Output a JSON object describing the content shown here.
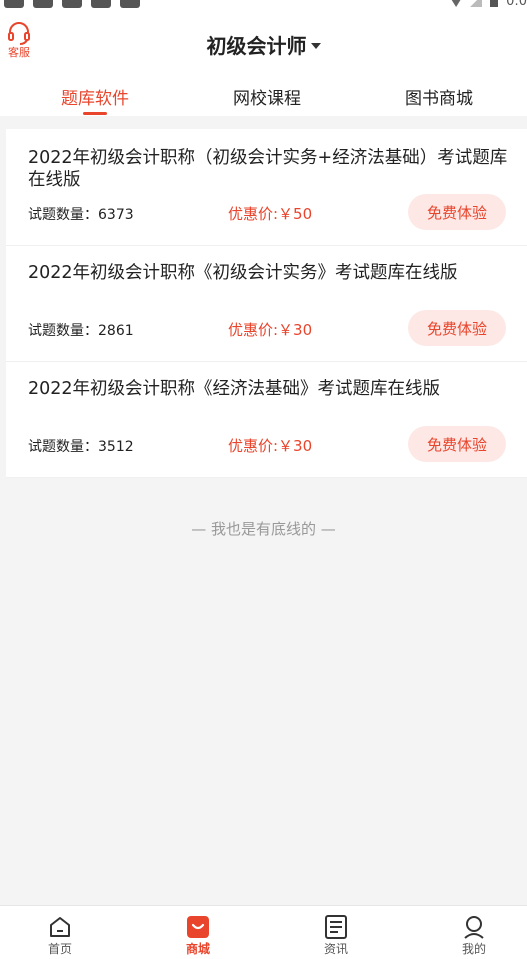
{
  "status_bar": {
    "time": "0:0"
  },
  "header": {
    "service_label": "客服",
    "title": "初级会计师"
  },
  "tabs": [
    {
      "label": "题库软件",
      "active": true
    },
    {
      "label": "网校课程",
      "active": false
    },
    {
      "label": "图书商城",
      "active": false
    }
  ],
  "products": [
    {
      "title": "2022年初级会计职称（初级会计实务+经济法基础）考试题库在线版",
      "count": "试题数量：6373",
      "price": "优惠价:￥50",
      "button": "免费体验"
    },
    {
      "title": "2022年初级会计职称《初级会计实务》考试题库在线版",
      "count": "试题数量：2861",
      "price": "优惠价:￥30",
      "button": "免费体验"
    },
    {
      "title": "2022年初级会计职称《经济法基础》考试题库在线版",
      "count": "试题数量：3512",
      "price": "优惠价:￥30",
      "button": "免费体验"
    }
  ],
  "footer_note": "— 我也是有底线的 —",
  "bottom_nav": [
    {
      "label": "首页",
      "icon": "home-icon",
      "active": false
    },
    {
      "label": "商城",
      "icon": "shop-bag-icon",
      "active": true
    },
    {
      "label": "资讯",
      "icon": "news-icon",
      "active": false
    },
    {
      "label": "我的",
      "icon": "profile-icon",
      "active": false
    }
  ],
  "colors": {
    "accent": "#e8452c",
    "button_bg": "#fde8e6",
    "background": "#f4f4f4"
  }
}
